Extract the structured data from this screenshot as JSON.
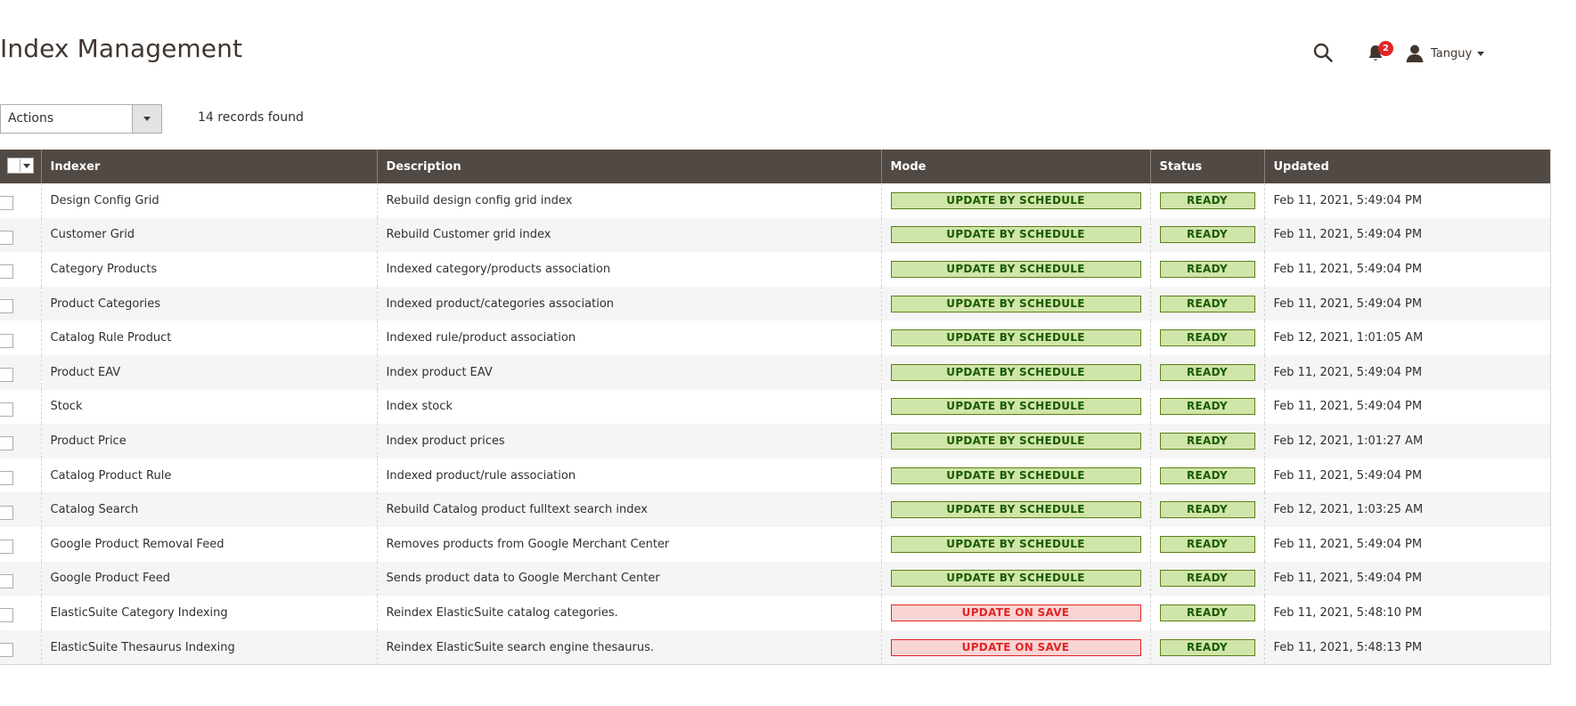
{
  "page": {
    "title": "Index Management"
  },
  "header": {
    "search_icon": "search-icon",
    "notifications_count": "2",
    "user_name": "Tanguy"
  },
  "toolbar": {
    "actions_label": "Actions",
    "records_found": "14 records found"
  },
  "table": {
    "columns": [
      "Indexer",
      "Description",
      "Mode",
      "Status",
      "Updated"
    ],
    "rows": [
      {
        "indexer": "Design Config Grid",
        "description": "Rebuild design config grid index",
        "mode": "UPDATE BY SCHEDULE",
        "status": "READY",
        "updated": "Feb 11, 2021, 5:49:04 PM"
      },
      {
        "indexer": "Customer Grid",
        "description": "Rebuild Customer grid index",
        "mode": "UPDATE BY SCHEDULE",
        "status": "READY",
        "updated": "Feb 11, 2021, 5:49:04 PM"
      },
      {
        "indexer": "Category Products",
        "description": "Indexed category/products association",
        "mode": "UPDATE BY SCHEDULE",
        "status": "READY",
        "updated": "Feb 11, 2021, 5:49:04 PM"
      },
      {
        "indexer": "Product Categories",
        "description": "Indexed product/categories association",
        "mode": "UPDATE BY SCHEDULE",
        "status": "READY",
        "updated": "Feb 11, 2021, 5:49:04 PM"
      },
      {
        "indexer": "Catalog Rule Product",
        "description": "Indexed rule/product association",
        "mode": "UPDATE BY SCHEDULE",
        "status": "READY",
        "updated": "Feb 12, 2021, 1:01:05 AM"
      },
      {
        "indexer": "Product EAV",
        "description": "Index product EAV",
        "mode": "UPDATE BY SCHEDULE",
        "status": "READY",
        "updated": "Feb 11, 2021, 5:49:04 PM"
      },
      {
        "indexer": "Stock",
        "description": "Index stock",
        "mode": "UPDATE BY SCHEDULE",
        "status": "READY",
        "updated": "Feb 11, 2021, 5:49:04 PM"
      },
      {
        "indexer": "Product Price",
        "description": "Index product prices",
        "mode": "UPDATE BY SCHEDULE",
        "status": "READY",
        "updated": "Feb 12, 2021, 1:01:27 AM"
      },
      {
        "indexer": "Catalog Product Rule",
        "description": "Indexed product/rule association",
        "mode": "UPDATE BY SCHEDULE",
        "status": "READY",
        "updated": "Feb 11, 2021, 5:49:04 PM"
      },
      {
        "indexer": "Catalog Search",
        "description": "Rebuild Catalog product fulltext search index",
        "mode": "UPDATE BY SCHEDULE",
        "status": "READY",
        "updated": "Feb 12, 2021, 1:03:25 AM"
      },
      {
        "indexer": "Google Product Removal Feed",
        "description": "Removes products from Google Merchant Center",
        "mode": "UPDATE BY SCHEDULE",
        "status": "READY",
        "updated": "Feb 11, 2021, 5:49:04 PM"
      },
      {
        "indexer": "Google Product Feed",
        "description": "Sends product data to Google Merchant Center",
        "mode": "UPDATE BY SCHEDULE",
        "status": "READY",
        "updated": "Feb 11, 2021, 5:49:04 PM"
      },
      {
        "indexer": "ElasticSuite Category Indexing",
        "description": "Reindex ElasticSuite catalog categories.",
        "mode": "UPDATE ON SAVE",
        "status": "READY",
        "updated": "Feb 11, 2021, 5:48:10 PM"
      },
      {
        "indexer": "ElasticSuite Thesaurus Indexing",
        "description": "Reindex ElasticSuite search engine thesaurus.",
        "mode": "UPDATE ON SAVE",
        "status": "READY",
        "updated": "Feb 11, 2021, 5:48:13 PM"
      }
    ]
  },
  "colors": {
    "header_bg": "#514943",
    "schedule_bg": "#d0e5a9",
    "schedule_text": "#185b00",
    "save_bg": "#f9d4d4",
    "save_text": "#e22626",
    "badge": "#e22626"
  }
}
